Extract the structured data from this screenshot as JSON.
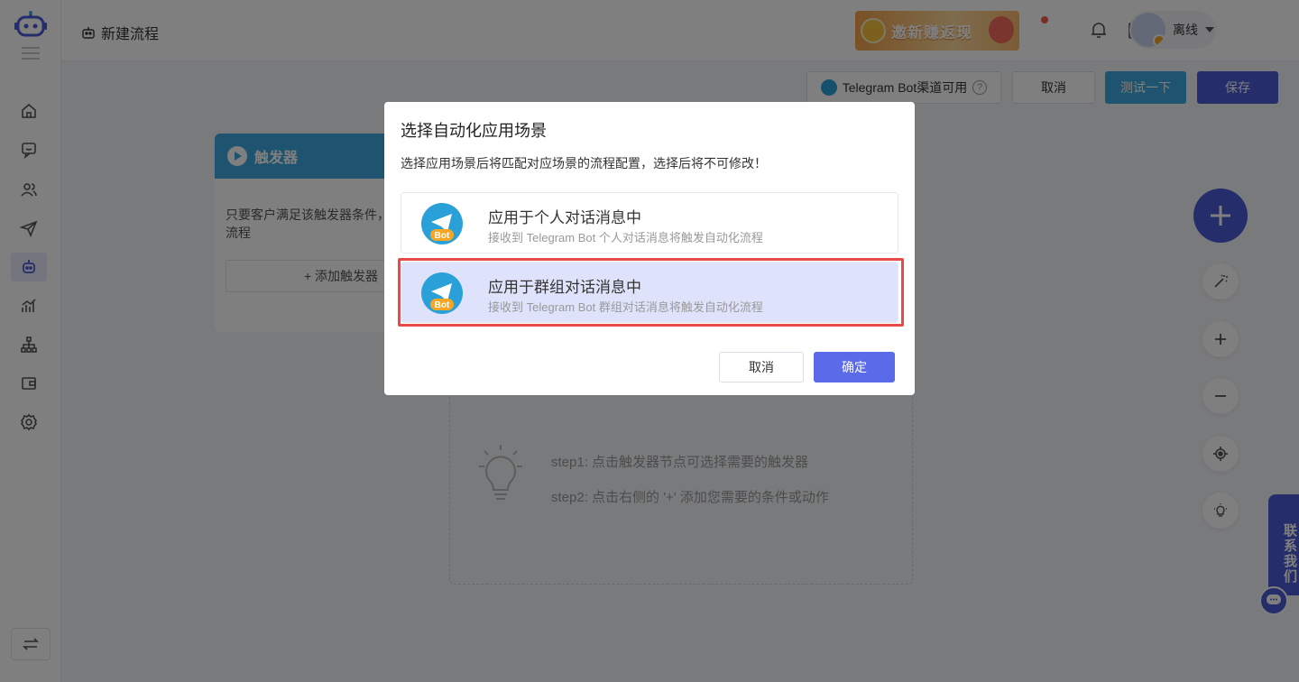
{
  "header": {
    "page_title": "新建流程",
    "promo_text": "邀新赚返现",
    "notification_count": "•",
    "user_status": "离线"
  },
  "toolbar": {
    "channel_label": "Telegram Bot渠道可用",
    "help_glyph": "?",
    "cancel_label": "取消",
    "test_label": "测试一下",
    "save_label": "保存"
  },
  "trigger": {
    "title": "触发器",
    "description": "只要客户满足该触发器条件，当前自动化流程",
    "add_label": "+ 添加触发器"
  },
  "steps": {
    "step1": "step1: 点击触发器节点可选择需要的触发器",
    "step2": "step2: 点击右侧的 '+' 添加您需要的条件或动作"
  },
  "contact": {
    "label": "联系我们"
  },
  "modal": {
    "title": "选择自动化应用场景",
    "subtitle": "选择应用场景后将匹配对应场景的流程配置，选择后将不可修改！",
    "options": [
      {
        "title": "应用于个人对话消息中",
        "description": "接收到 Telegram Bot 个人对话消息将触发自动化流程",
        "badge": "Bot",
        "selected": false
      },
      {
        "title": "应用于群组对话消息中",
        "description": "接收到 Telegram Bot 群组对话消息将触发自动化流程",
        "badge": "Bot",
        "selected": true
      }
    ],
    "cancel_label": "取消",
    "ok_label": "确定"
  },
  "colors": {
    "primary": "#4a5bd6",
    "accent": "#3fa9e0",
    "selected_bg": "#dfe2fb",
    "highlight": "#e84a4a"
  }
}
